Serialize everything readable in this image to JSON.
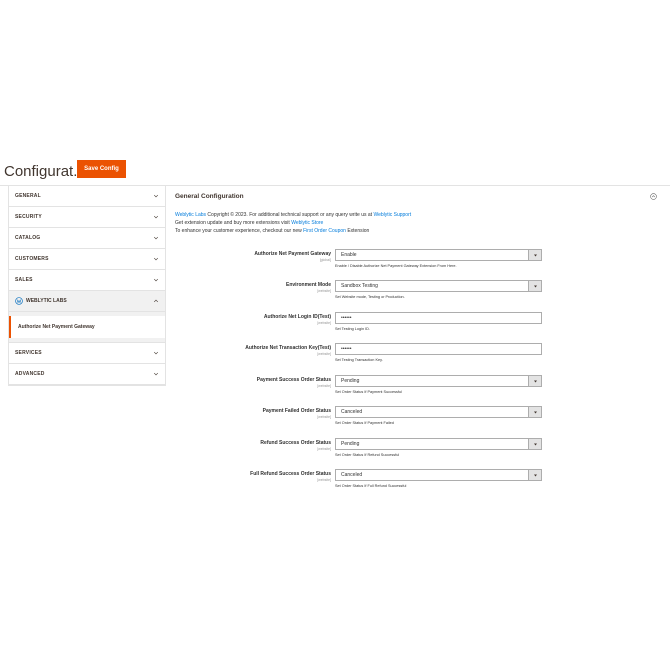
{
  "header": {
    "title": "Configurat...",
    "save_label": "Save Config"
  },
  "colors": {
    "accent": "#eb5202",
    "link": "#007bdb"
  },
  "sidebar": {
    "items": [
      {
        "label": "GENERAL"
      },
      {
        "label": "SECURITY"
      },
      {
        "label": "CATALOG"
      },
      {
        "label": "CUSTOMERS"
      },
      {
        "label": "SALES"
      }
    ],
    "weblytic": {
      "label": "WEBLYTIC LABS",
      "sub": "Authorize Net Payment Gateway"
    },
    "items_after": [
      {
        "label": "SERVICES"
      },
      {
        "label": "ADVANCED"
      }
    ]
  },
  "main": {
    "section_title": "General Configuration",
    "intro": {
      "line1_link1": "Weblytic Labs",
      "line1_text": " Copyright © 2023. For additional technical support or any query write us at ",
      "line1_link2": "Weblytic Support",
      "line2_text": "Get extension update and buy more extensions visit ",
      "line2_link": "Weblytic Store",
      "line3_text": "To enhance your customer experience, checkout our new ",
      "line3_link": "First Order Coupon",
      "line3_end": " Extension"
    },
    "fields": [
      {
        "label": "Authorize Net Payment Gateway",
        "scope": "[global]",
        "value": "Enable",
        "note": "Enable / Disable Authorize Net Payment Gateway Extension From Here.",
        "type": "select"
      },
      {
        "label": "Environment Mode",
        "scope": "[website]",
        "value": "Sandbox Testing",
        "note": "Set Website mode, Testing or Production.",
        "type": "select"
      },
      {
        "label": "Authorize Net Login ID(Test)",
        "scope": "[website]",
        "value": "••••••",
        "note": "Set Testing Login ID.",
        "type": "password"
      },
      {
        "label": "Authorize Net Transaction Key(Test)",
        "scope": "[website]",
        "value": "••••••",
        "note": "Set Testing Transaction Key.",
        "type": "password"
      },
      {
        "label": "Payment Success Order Status",
        "scope": "[website]",
        "value": "Pending",
        "note": "Set Order Status If Payment Successful",
        "type": "select"
      },
      {
        "label": "Payment Failed Order Status",
        "scope": "[website]",
        "value": "Canceled",
        "note": "Set Order Status If Payment Failed",
        "type": "select"
      },
      {
        "label": "Refund Success Order Status",
        "scope": "[website]",
        "value": "Pending",
        "note": "Set Order Status If Refund Successful",
        "type": "select"
      },
      {
        "label": "Full Refund Success Order Status",
        "scope": "[website]",
        "value": "Canceled",
        "note": "Set Order Status If Full Refund Successful",
        "type": "select"
      }
    ]
  }
}
